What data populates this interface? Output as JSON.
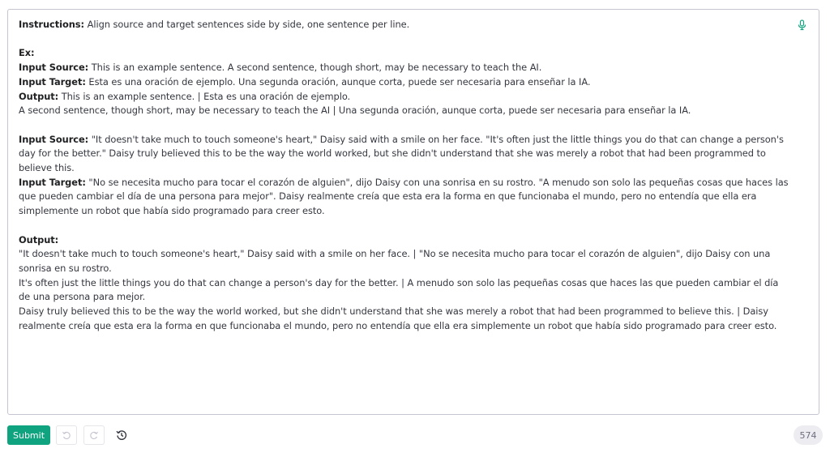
{
  "prompt": {
    "instructions_label": "Instructions:",
    "instructions_text": " Align source and target sentences side by side, one sentence per line.",
    "ex_label": "Ex:",
    "ex_source_label": "Input Source:",
    "ex_source_text": " This is an example sentence. A second sentence, though short, may be necessary to teach the AI.",
    "ex_target_label": "Input Target:",
    "ex_target_text": " Esta es una oración de ejemplo. Una segunda oración, aunque corta, puede ser necesaria para enseñar la IA.",
    "ex_output_label": "Output:",
    "ex_output_line1": " This is an example sentence. | Esta es una oración de ejemplo.",
    "ex_output_line2": "A second sentence, though short, may be necessary to teach the AI | Una segunda oración, aunque corta, puede ser necesaria para enseñar la IA.",
    "source_label": "Input Source:",
    "source_text": " \"It doesn't take much to touch someone's heart,\" Daisy said with a smile on her face. \"It's often just the little things you do that can change a person's day for the better.\" Daisy truly believed this to be the way the world worked, but she didn't understand that she was merely a robot that had been programmed to believe this.",
    "target_label": "Input Target:",
    "target_text": " \"No se necesita mucho para tocar el corazón de alguien\", dijo Daisy con una sonrisa en su rostro. \"A menudo son solo las pequeñas cosas que haces las que pueden cambiar el día de una persona para mejor\". Daisy realmente creía que esta era la forma en que funcionaba el mundo, pero no entendía que ella era simplemente un robot que había sido programado para creer esto.",
    "output_label": "Output:",
    "output_line1": "\"It doesn't take much to touch someone's heart,\" Daisy said with a smile on her face. | \"No se necesita mucho para tocar el corazón de alguien\", dijo Daisy con una sonrisa en su rostro.",
    "output_line2": "It's often just the little things you do that can change a person's day for the better. | A menudo son solo las pequeñas cosas que haces las que pueden cambiar el día de una persona para mejor.",
    "output_line3": "Daisy truly believed this to be the way the world worked, but she didn't understand that she was merely a robot that had been programmed to believe this. | Daisy realmente creía que esta era la forma en que funcionaba el mundo, pero no entendía que ella era simplemente un robot que había sido programado para creer esto."
  },
  "toolbar": {
    "submit_label": "Submit",
    "token_count": "574"
  },
  "icons": {
    "mic": "microphone-icon",
    "undo": "undo-icon",
    "redo": "redo-icon",
    "history": "history-icon"
  },
  "colors": {
    "accent": "#10a37f",
    "text": "#353740",
    "border": "#c5c5d2",
    "muted": "#6e6e80",
    "badge_bg": "#ececf1"
  }
}
